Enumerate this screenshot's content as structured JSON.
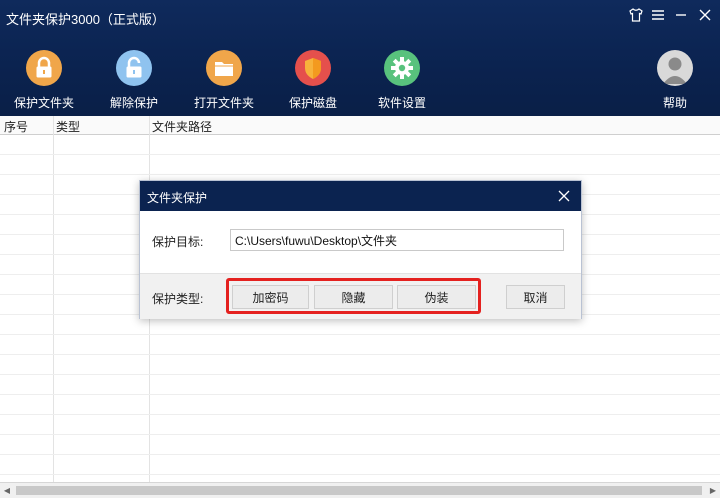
{
  "app": {
    "title": "文件夹保护3000（正式版）"
  },
  "toolbar": {
    "items": [
      {
        "label": "保护文件夹",
        "icon": "lock-icon",
        "color": "#f0a64a"
      },
      {
        "label": "解除保护",
        "icon": "unlock-icon",
        "color": "#8fc3ef"
      },
      {
        "label": "打开文件夹",
        "icon": "folder-icon",
        "color": "#f0a64a"
      },
      {
        "label": "保护磁盘",
        "icon": "shield-icon",
        "color": "#e5504c"
      },
      {
        "label": "软件设置",
        "icon": "gear-icon",
        "color": "#58c27d"
      }
    ],
    "help_label": "帮助"
  },
  "table": {
    "columns": [
      "序号",
      "类型",
      "文件夹路径"
    ]
  },
  "dialog": {
    "title": "文件夹保护",
    "target_label": "保护目标:",
    "target_value": "C:\\Users\\fuwu\\Desktop\\文件夹",
    "type_label": "保护类型:",
    "buttons": {
      "encrypt": "加密码",
      "hide": "隐藏",
      "disguise": "伪装",
      "cancel": "取消"
    }
  },
  "colors": {
    "header_bg": "#0b2350",
    "highlight": "#e4211f"
  }
}
